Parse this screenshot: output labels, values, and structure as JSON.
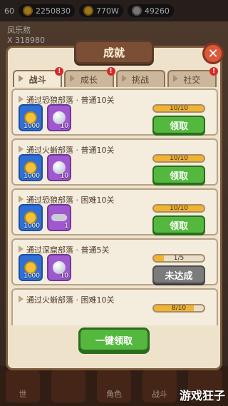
{
  "top_bar": {
    "level": "60",
    "currency_a": "2250830",
    "currency_b": "770W",
    "currency_c": "49260"
  },
  "profile": {
    "name": "凤乐熬",
    "score": "X 318980"
  },
  "title": "成就",
  "tabs": [
    {
      "label": "战斗",
      "active": true
    },
    {
      "label": "成长",
      "active": false
    },
    {
      "label": "挑战",
      "active": false
    },
    {
      "label": "社交",
      "active": false
    }
  ],
  "cards": [
    {
      "title": "通过恐狼部落 · 普通10关",
      "rewards": [
        {
          "type": "gold",
          "amount": "1000"
        },
        {
          "type": "orb",
          "amount": "10"
        }
      ],
      "progress": "10/10",
      "progress_fraction": 1.0,
      "button": "领取",
      "state": "claim"
    },
    {
      "title": "通过火蜥部落 · 普通10关",
      "rewards": [
        {
          "type": "gold",
          "amount": "1000"
        },
        {
          "type": "orb",
          "amount": "10"
        }
      ],
      "progress": "10/10",
      "progress_fraction": 1.0,
      "button": "领取",
      "state": "claim"
    },
    {
      "title": "通过恐狼部落 · 困难10关",
      "rewards": [
        {
          "type": "gold",
          "amount": "1000"
        },
        {
          "type": "key",
          "amount": "1"
        }
      ],
      "progress": "10/10",
      "progress_fraction": 1.0,
      "button": "领取",
      "state": "claim"
    },
    {
      "title": "通过深窟部落 · 普通5关",
      "rewards": [
        {
          "type": "gold",
          "amount": "1000"
        },
        {
          "type": "orb",
          "amount": "10"
        }
      ],
      "progress": "1/5",
      "progress_fraction": 0.2,
      "button": "未达成",
      "state": "pending"
    },
    {
      "title": "通过火蜥部落 · 困难10关",
      "rewards": [],
      "progress": "8/10",
      "progress_fraction": 0.8,
      "button": "",
      "state": "partial"
    }
  ],
  "one_click_button": "一键领取",
  "bottom_nav": [
    {
      "label": "世"
    },
    {
      "label": ""
    },
    {
      "label": "角色"
    },
    {
      "label": "战斗"
    },
    {
      "label": ""
    }
  ],
  "watermark": "游戏狂子"
}
